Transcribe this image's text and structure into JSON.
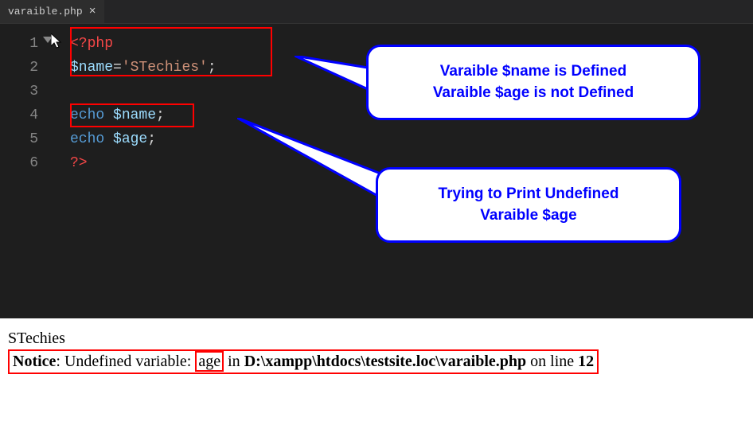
{
  "tab": {
    "filename": "varaible.php"
  },
  "gutter": [
    "1",
    "2",
    "3",
    "4",
    "5",
    "6"
  ],
  "code": {
    "l1": {
      "tag": "<?php"
    },
    "l2": {
      "var": "$name",
      "op": "=",
      "str": "'STechies'",
      "semi": ";"
    },
    "l4": {
      "echo": "echo",
      "var": "$name",
      "semi": ";"
    },
    "l5": {
      "echo": "echo",
      "var": "$age",
      "semi": ";"
    },
    "l6": {
      "tag": "?>"
    }
  },
  "callouts": {
    "c1a": "Varaible $name is Defined",
    "c1b": "Varaible $age is not Defined",
    "c2a": "Trying to Print Undefined",
    "c2b": "Varaible $age"
  },
  "output": {
    "line1": "STechies",
    "notice_label": "Notice",
    "notice_sep": ": Undefined variable: ",
    "age": "age",
    "in": " in ",
    "path": "D:\\xampp\\htdocs\\testsite.loc\\varaible.php",
    "online": " on line ",
    "linenum": "12"
  }
}
